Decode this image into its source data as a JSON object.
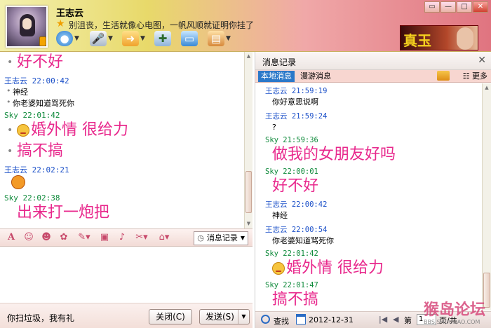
{
  "header": {
    "name": "王志云",
    "signature": "别沮丧，生活就像心电图，一帆风顺就证明你挂了",
    "banner_text": "真玉",
    "window_buttons": [
      "▭",
      "—",
      "□",
      "✕"
    ]
  },
  "left_chat": [
    {
      "kind": "big",
      "text": "好不好",
      "dot": true
    },
    {
      "kind": "head",
      "who": "me",
      "text": "王志云  22:00:42"
    },
    {
      "kind": "line",
      "text": "神经"
    },
    {
      "kind": "line",
      "text": "你老婆知道骂死你"
    },
    {
      "kind": "head",
      "who": "other",
      "text": "Sky  22:01:42"
    },
    {
      "kind": "big",
      "text": "婚外情  很给力",
      "dot": true,
      "emoji": true
    },
    {
      "kind": "big",
      "text": "搞不搞",
      "dot": true
    },
    {
      "kind": "head",
      "who": "me",
      "text": "王志云  22:02:21"
    },
    {
      "kind": "angry"
    },
    {
      "kind": "head",
      "who": "other",
      "text": "Sky  22:02:38"
    },
    {
      "kind": "big",
      "text": "出来打一炮把",
      "dot": false
    }
  ],
  "editor": {
    "msg_record_label": "消息记录",
    "bottom_text": "你扫垃圾，我有礼",
    "close_label": "关闭(C)",
    "send_label": "发送(S)"
  },
  "history": {
    "title": "消息记录",
    "tab_local": "本地消息",
    "tab_roaming": "漫游消息",
    "more_label": "更多",
    "entries": [
      {
        "kind": "head",
        "who": "me",
        "text": "王志云  21:59:19"
      },
      {
        "kind": "line",
        "text": "你好意思说啊"
      },
      {
        "kind": "head",
        "who": "me",
        "text": "王志云  21:59:24"
      },
      {
        "kind": "line",
        "text": "?"
      },
      {
        "kind": "head",
        "who": "other",
        "text": "Sky  21:59:36"
      },
      {
        "kind": "big",
        "text": "做我的女朋友好吗"
      },
      {
        "kind": "head",
        "who": "other",
        "text": "Sky  22:00:01"
      },
      {
        "kind": "big",
        "text": "好不好"
      },
      {
        "kind": "head",
        "who": "me",
        "text": "王志云  22:00:42"
      },
      {
        "kind": "line",
        "text": "神经"
      },
      {
        "kind": "head",
        "who": "me",
        "text": "王志云  22:00:54"
      },
      {
        "kind": "line",
        "text": "你老婆知道骂死你"
      },
      {
        "kind": "head",
        "who": "other",
        "text": "Sky  22:01:42"
      },
      {
        "kind": "big",
        "text": "婚外情  很给力",
        "emoji": true
      },
      {
        "kind": "head",
        "who": "other",
        "text": "Sky  22:01:47"
      },
      {
        "kind": "big",
        "text": "搞不搞"
      }
    ],
    "search_label": "查找",
    "date": "2012-12-31",
    "page_label": "第",
    "page_value": "1",
    "total_label": "页/共"
  },
  "watermark": {
    "main": "猴岛论坛",
    "sub": "BBS.SHOUDAO.COM"
  }
}
